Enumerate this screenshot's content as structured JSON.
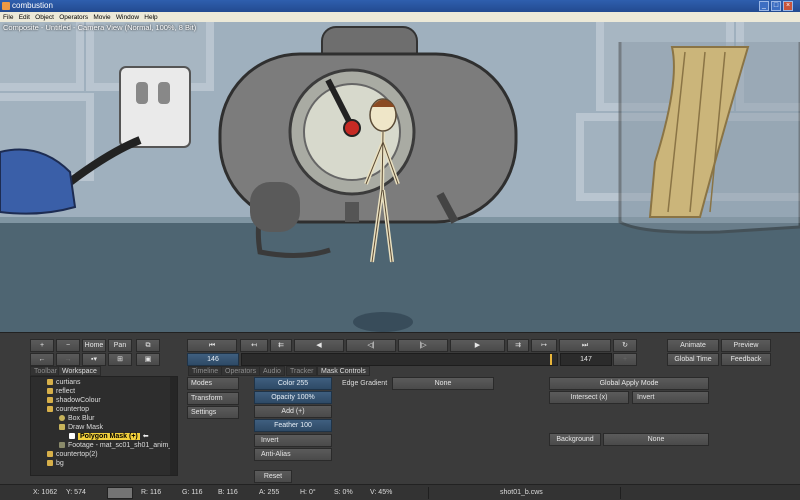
{
  "window": {
    "title": "combustion",
    "controls": [
      "_",
      "□",
      "×"
    ]
  },
  "menu": [
    "File",
    "Edit",
    "Object",
    "Operators",
    "Movie",
    "Window",
    "Help"
  ],
  "viewport": {
    "title": "Composite - Untitled - Camera View (Normal, 100%, 8 Bit)"
  },
  "transport": {
    "left_controls": [
      "+",
      "−",
      "Home",
      "Pan",
      "←",
      "→"
    ],
    "playback": [
      "⏮",
      "↤",
      "⇇",
      "◀",
      "◁|",
      "|▷",
      "▶",
      "⇉",
      "↦",
      "⏭",
      "↻"
    ],
    "current_frame": "146",
    "end_frame": "147",
    "progress": 0.985
  },
  "right_buttons": {
    "animate": "Animate",
    "preview": "Preview",
    "global_time": "Global Time",
    "feedback": "Feedback"
  },
  "tabs": {
    "left": [
      "Toolbar",
      "Workspace"
    ],
    "right": [
      "Timeline",
      "Operators",
      "Audio",
      "Tracker",
      "Mask Controls"
    ]
  },
  "tree": [
    {
      "label": "curtians",
      "indent": 1
    },
    {
      "label": "reflect",
      "indent": 1
    },
    {
      "label": "shadowColour",
      "indent": 1
    },
    {
      "label": "countertop",
      "indent": 1
    },
    {
      "label": "Box Blur",
      "indent": 2
    },
    {
      "label": "Draw Mask",
      "indent": 2
    },
    {
      "label": "Polygon Mask (+)",
      "indent": 3,
      "selected": true
    },
    {
      "label": "Footage - mat_sc01_sh01_anim_v",
      "indent": 2
    },
    {
      "label": "countertop(2)",
      "indent": 1
    },
    {
      "label": "bg",
      "indent": 1
    }
  ],
  "side_buttons": [
    "Modes",
    "Transform",
    "Settings"
  ],
  "mask": {
    "color": "Color 255",
    "opacity": "Opacity 100%",
    "add": "Add  (+)",
    "feather": "Feather 100",
    "invert": "Invert",
    "antialias": "Anti-Alias",
    "reset": "Reset"
  },
  "edge_gradient": {
    "label": "Edge Gradient",
    "value": "None"
  },
  "global_apply": {
    "label": "Global Apply Mode",
    "intersect": "Intersect  (x)",
    "invert": "Invert"
  },
  "background": {
    "label": "Background",
    "value": "None"
  },
  "status": {
    "x": "X:  1062",
    "y": "Y:  574",
    "r": "R: 116",
    "g": "G: 116",
    "b": "B: 116",
    "a": "A: 255",
    "h": "H: 0°",
    "s": "S: 0%",
    "v": "V: 45%",
    "file": "shot01_b.cws"
  },
  "colors": {
    "accent": "#3f5f7f",
    "selected": "#f2d03c",
    "playhead": "#e8b53a"
  }
}
